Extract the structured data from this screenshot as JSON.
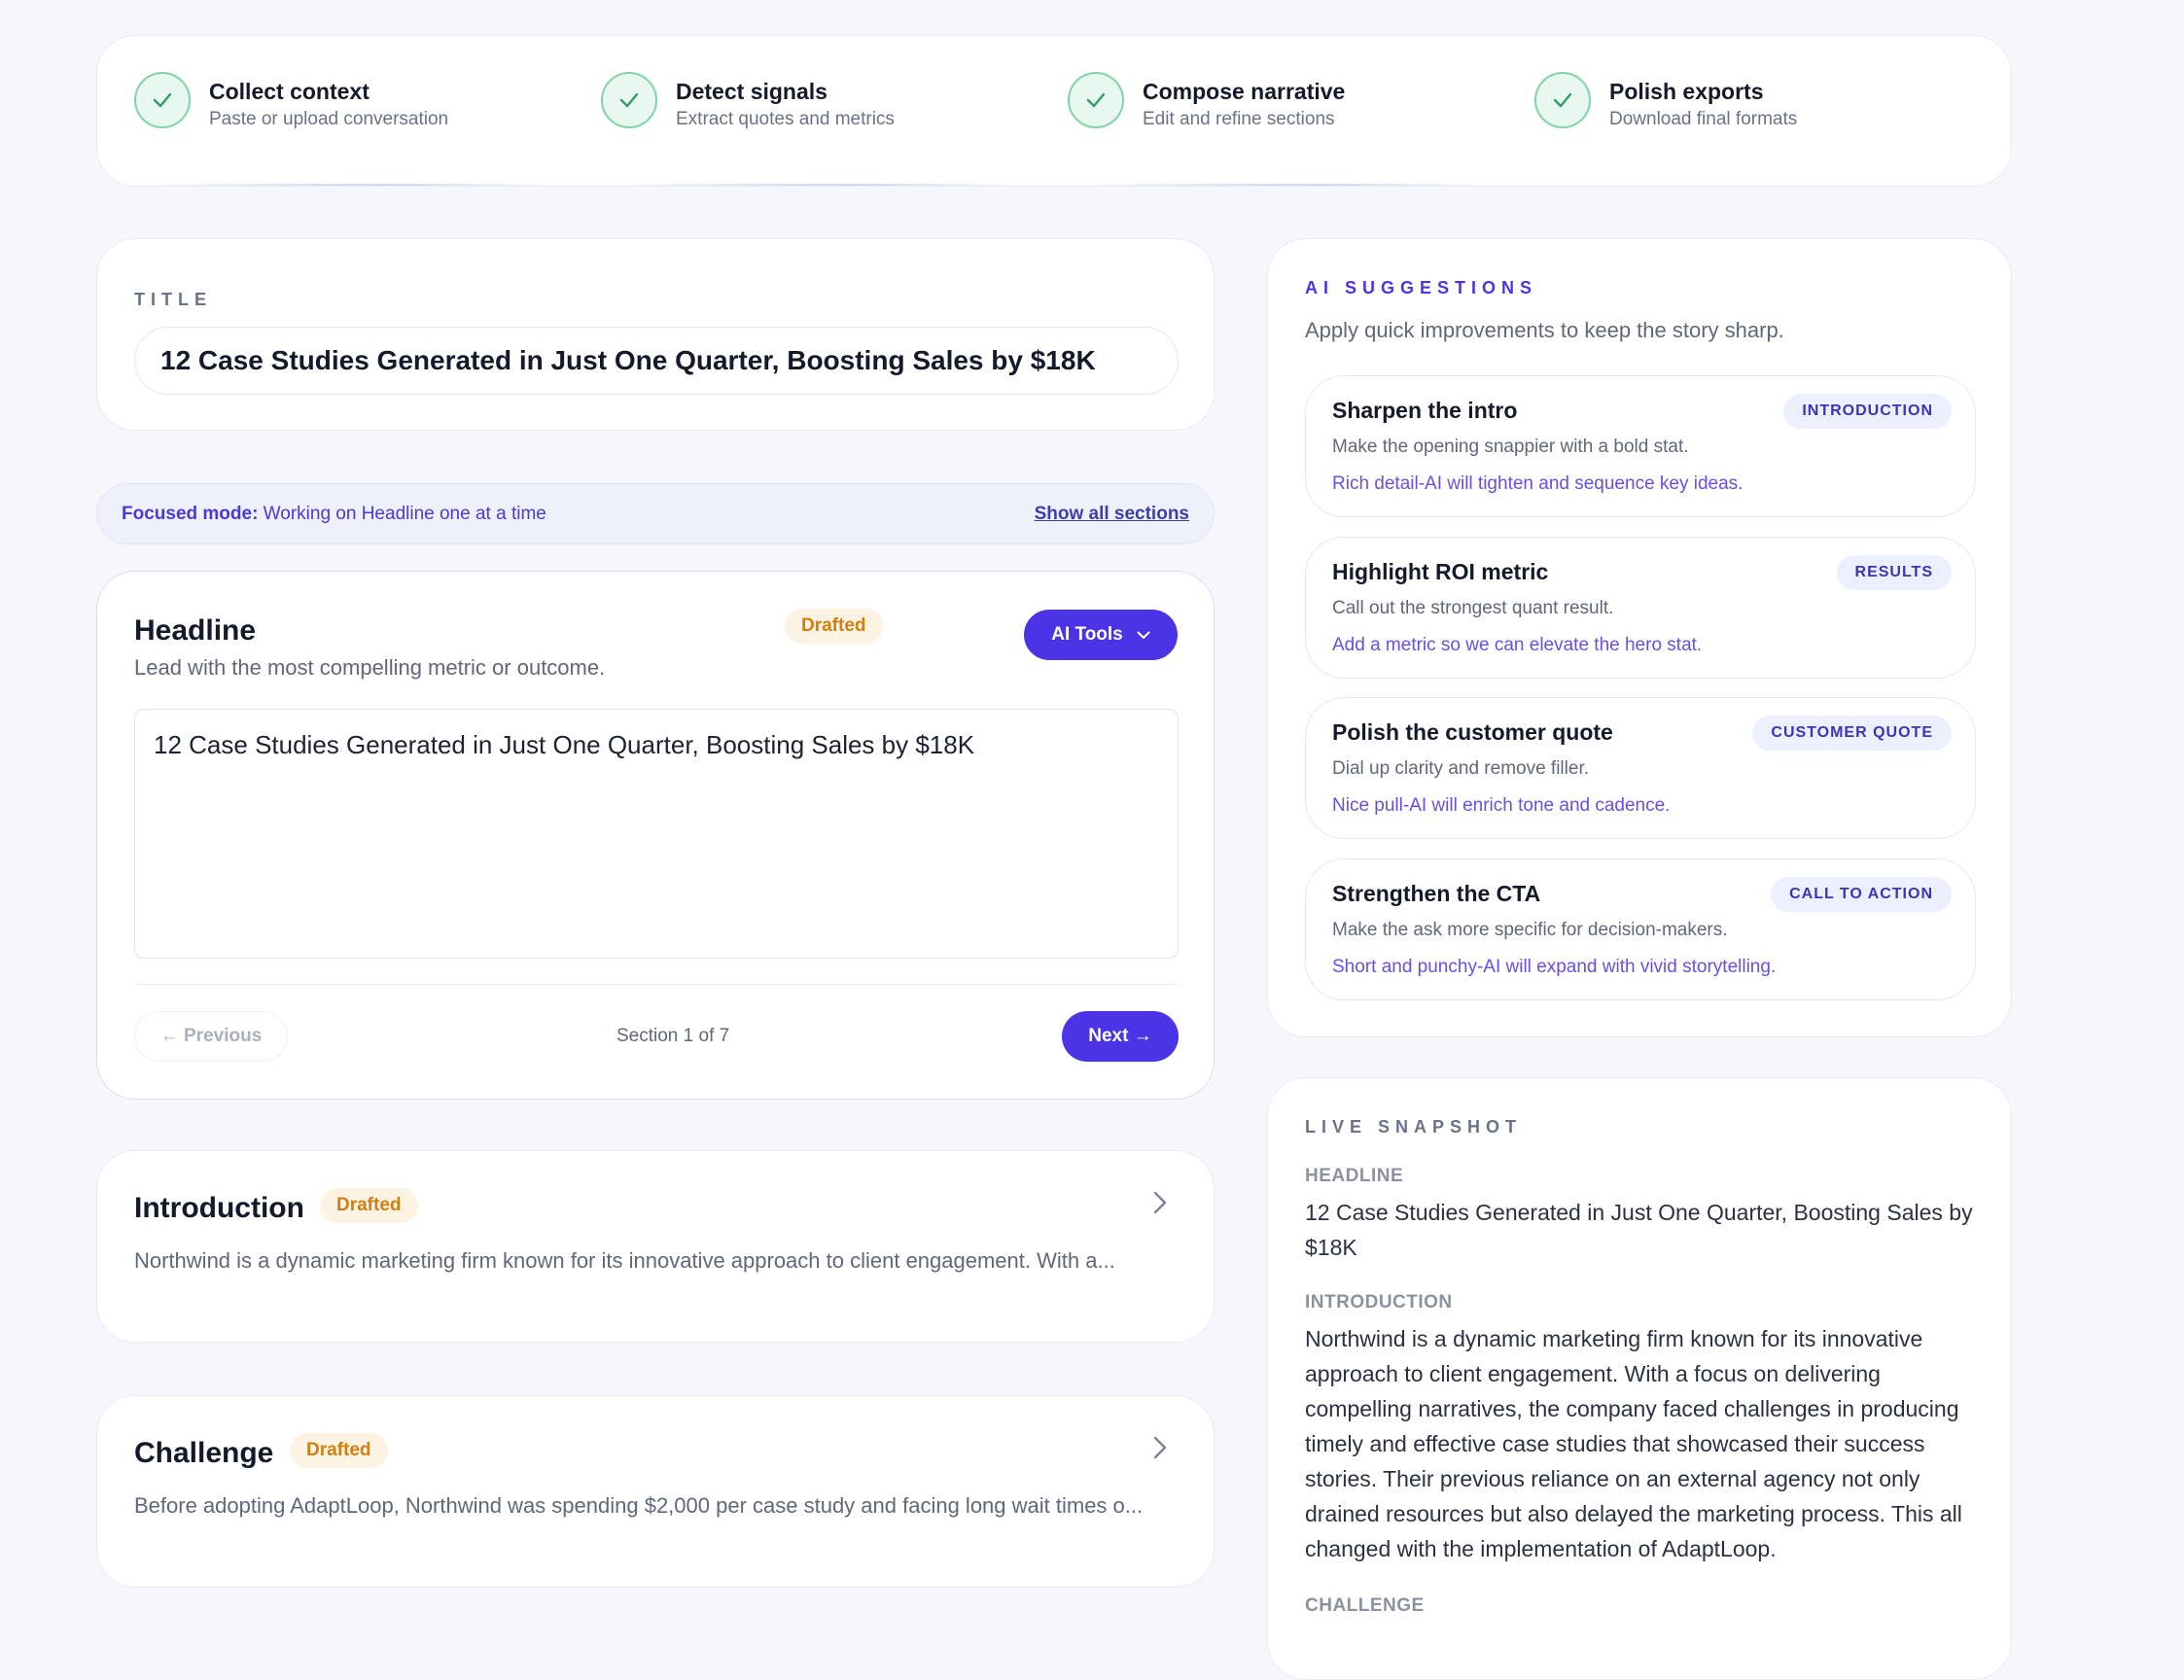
{
  "stepper": {
    "steps": [
      {
        "title": "Collect context",
        "subtitle": "Paste or upload conversation"
      },
      {
        "title": "Detect signals",
        "subtitle": "Extract quotes and metrics"
      },
      {
        "title": "Compose narrative",
        "subtitle": "Edit and refine sections"
      },
      {
        "title": "Polish exports",
        "subtitle": "Download final formats"
      }
    ]
  },
  "title_card": {
    "label": "TITLE",
    "value": "12 Case Studies Generated in Just One Quarter, Boosting Sales by $18K"
  },
  "focus_banner": {
    "prefix": "Focused mode:",
    "text": " Working on Headline one at a time",
    "link": "Show all sections"
  },
  "editor": {
    "title": "Headline",
    "subtitle": "Lead with the most compelling metric or outcome.",
    "status": "Drafted",
    "ai_tools_label": "AI Tools",
    "content": "12 Case Studies Generated in Just One Quarter, Boosting Sales by $18K",
    "prev_label": "← Previous",
    "section_counter": "Section 1 of 7",
    "next_label": "Next →"
  },
  "sections": [
    {
      "title": "Introduction",
      "status": "Drafted",
      "preview": "Northwind is a dynamic marketing firm known for its innovative approach to client engagement. With a..."
    },
    {
      "title": "Challenge",
      "status": "Drafted",
      "preview": "Before adopting AdaptLoop, Northwind was spending $2,000 per case study and facing long wait times o..."
    }
  ],
  "ai_suggestions": {
    "label": "AI SUGGESTIONS",
    "subtitle": "Apply quick improvements to keep the story sharp.",
    "items": [
      {
        "title": "Sharpen the intro",
        "tag": "INTRODUCTION",
        "description": "Make the opening snappier with a bold stat.",
        "note": "Rich detail-AI will tighten and sequence key ideas."
      },
      {
        "title": "Highlight ROI metric",
        "tag": "RESULTS",
        "description": "Call out the strongest quant result.",
        "note": "Add a metric so we can elevate the hero stat."
      },
      {
        "title": "Polish the customer quote",
        "tag": "CUSTOMER QUOTE",
        "description": "Dial up clarity and remove filler.",
        "note": "Nice pull-AI will enrich tone and cadence."
      },
      {
        "title": "Strengthen the CTA",
        "tag": "CALL TO ACTION",
        "description": "Make the ask more specific for decision-makers.",
        "note": "Short and punchy-AI will expand with vivid storytelling."
      }
    ]
  },
  "live_snapshot": {
    "label": "LIVE SNAPSHOT",
    "headline_label": "HEADLINE",
    "headline": "12 Case Studies Generated in Just One Quarter, Boosting Sales by $18K",
    "introduction_label": "INTRODUCTION",
    "introduction": "Northwind is a dynamic marketing firm known for its innovative approach to client engagement. With a focus on delivering compelling narratives, the company faced challenges in producing timely and effective case studies that showcased their success stories. Their previous reliance on an external agency not only drained resources but also delayed the marketing process. This all changed with the implementation of AdaptLoop.",
    "challenge_label": "CHALLENGE"
  },
  "colors": {
    "accent": "#4b33e6",
    "drafted_text": "#d17f10",
    "drafted_bg": "#fdf3e3",
    "step_complete": "#2f9e6a"
  }
}
